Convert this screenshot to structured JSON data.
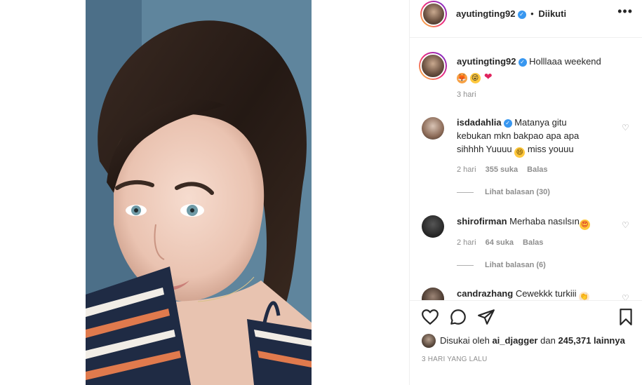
{
  "post": {
    "username": "ayutingting92",
    "verified": true,
    "dot": "•",
    "follow_status": "Diikuti",
    "more_icon": "more-horizontal-icon",
    "caption": {
      "username": "ayutingting92",
      "text": "Holllaaa weekend",
      "emojis": [
        "fox-face-emoji",
        "winking-tongue-emoji",
        "red-heart-emoji"
      ],
      "time": "3 hari"
    },
    "comments": [
      {
        "username": "isdadahlia",
        "verified": true,
        "line1": "Matanya gitu",
        "line2": "kebukan mkn bakpao apa apa",
        "line3": "sihhhh Yuuuu",
        "line3_emoji": "grinning-emoji",
        "line3_tail": "miss youuu",
        "time": "2 hari",
        "likes": "355 suka",
        "reply": "Balas",
        "view_replies": "Lihat balasan (30)"
      },
      {
        "username": "shirofirman",
        "text": "Merhaba nasılsın",
        "emoji": "heart-eyes-emoji",
        "time": "2 hari",
        "likes": "64 suka",
        "reply": "Balas",
        "view_replies": "Lihat balasan (6)"
      },
      {
        "username": "candrazhang",
        "text": "Cewekkk turkiii",
        "emoji": "clapping-emoji"
      }
    ],
    "actions": {
      "like_icon": "heart-icon",
      "comment_icon": "comment-icon",
      "share_icon": "send-icon",
      "save_icon": "bookmark-icon"
    },
    "liked_by": {
      "prefix": "Disukai oleh",
      "user": "ai_djagger",
      "conj": "dan",
      "others": "245,371 lainnya"
    },
    "date": "3 HARI YANG LALU"
  },
  "colors": {
    "verified": "#3897f0",
    "text": "#262626",
    "secondary": "#8e8e8e",
    "border": "#efefef"
  }
}
